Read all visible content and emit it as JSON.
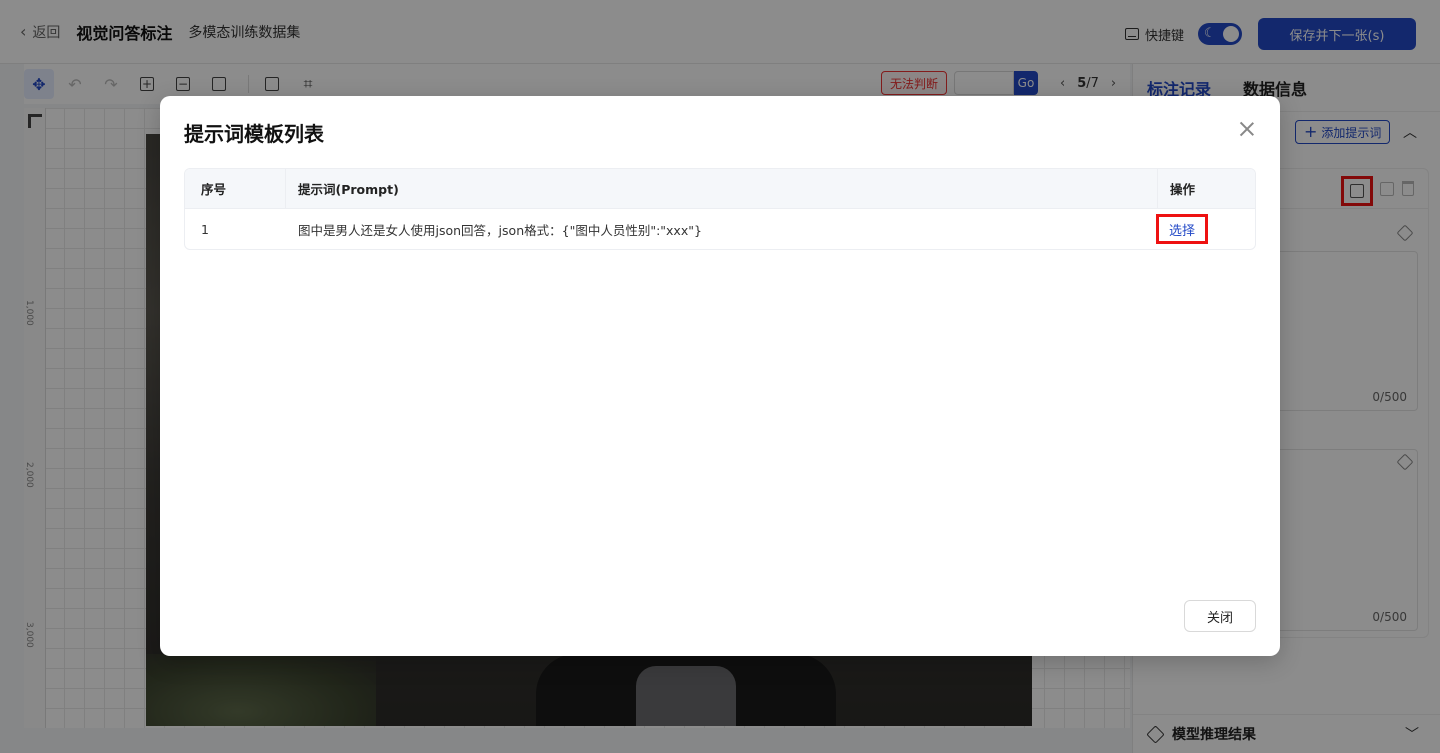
{
  "header": {
    "back_label": "返回",
    "title": "视觉问答标注",
    "dataset": "多模态训练数据集",
    "shortcut_label": "快捷键",
    "save_next_label": "保存并下一张(s)"
  },
  "toolbar": {
    "unjudgeable_label": "无法判断",
    "go_label": "Go",
    "current_page": "5",
    "total_pages": "/7"
  },
  "canvas": {
    "ruler_labels": [
      "1,000",
      "2,000",
      "3,000"
    ]
  },
  "right_panel": {
    "tabs": [
      "标注记录",
      "数据信息"
    ],
    "add_prompt_label": "添加提示词",
    "counter_1": "0/500",
    "counter_2": "0/500",
    "model_result_label": "模型推理结果"
  },
  "modal": {
    "title": "提示词模板列表",
    "columns": [
      "序号",
      "提示词(Prompt)",
      "操作"
    ],
    "rows": [
      {
        "index": "1",
        "prompt": "图中是男人还是女人使用json回答，json格式：{\"图中人员性别\":\"xxx\"}",
        "action": "选择"
      }
    ],
    "close_label": "关闭"
  },
  "colors": {
    "primary": "#2349c7",
    "highlight_border": "#e11111",
    "danger": "#e33333"
  }
}
